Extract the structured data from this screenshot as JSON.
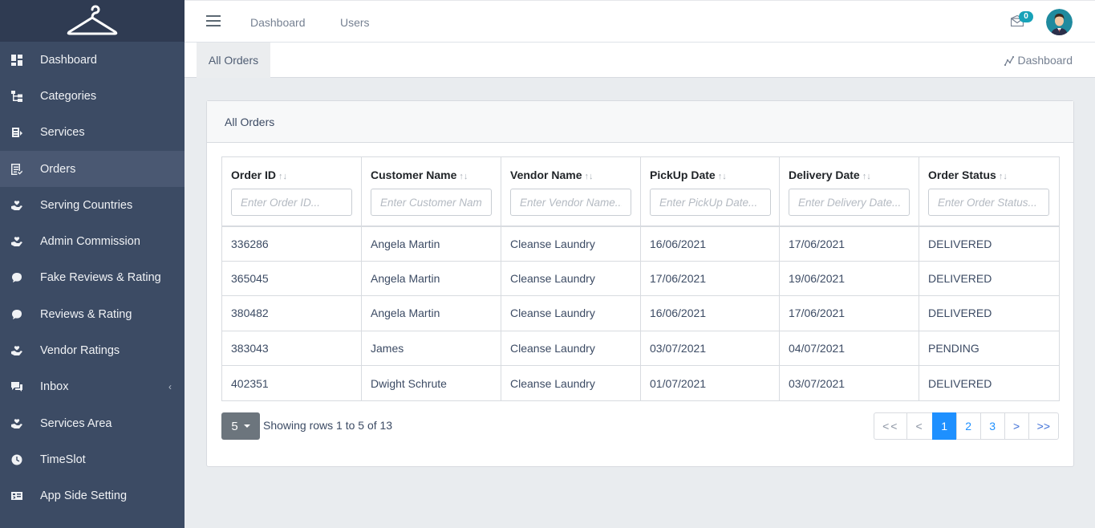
{
  "sidebar": {
    "items": [
      {
        "label": "Dashboard",
        "icon": "dashboard-icon"
      },
      {
        "label": "Categories",
        "icon": "sitemap-icon"
      },
      {
        "label": "Services",
        "icon": "services-icon"
      },
      {
        "label": "Orders",
        "icon": "orders-icon",
        "active": true
      },
      {
        "label": "Serving Countries",
        "icon": "hand-heart-icon"
      },
      {
        "label": "Admin Commission",
        "icon": "hand-heart-icon"
      },
      {
        "label": "Fake Reviews & Rating",
        "icon": "comment-icon"
      },
      {
        "label": "Reviews & Rating",
        "icon": "comment-icon"
      },
      {
        "label": "Vendor Ratings",
        "icon": "hand-heart-icon"
      },
      {
        "label": "Inbox",
        "icon": "inbox-icon",
        "caret": "‹"
      },
      {
        "label": "Services Area",
        "icon": "hand-heart-icon"
      },
      {
        "label": "TimeSlot",
        "icon": "clock-icon"
      },
      {
        "label": "App Side Setting",
        "icon": "settings-card-icon"
      }
    ]
  },
  "topbar": {
    "links": [
      "Dashboard",
      "Users"
    ],
    "mail_badge": "0"
  },
  "subheader": {
    "tab": "All Orders",
    "right_link": "Dashboard"
  },
  "card": {
    "title": "All Orders",
    "columns": [
      {
        "label": "Order ID",
        "placeholder": "Enter Order ID..."
      },
      {
        "label": "Customer Name",
        "placeholder": "Enter Customer Name..."
      },
      {
        "label": "Vendor Name",
        "placeholder": "Enter Vendor Name..."
      },
      {
        "label": "PickUp Date",
        "placeholder": "Enter PickUp Date..."
      },
      {
        "label": "Delivery Date",
        "placeholder": "Enter Delivery Date..."
      },
      {
        "label": "Order Status",
        "placeholder": "Enter Order Status..."
      }
    ],
    "rows": [
      [
        "336286",
        "Angela Martin",
        "Cleanse Laundry",
        "16/06/2021",
        "17/06/2021",
        "DELIVERED"
      ],
      [
        "365045",
        "Angela Martin",
        "Cleanse Laundry",
        "17/06/2021",
        "19/06/2021",
        "DELIVERED"
      ],
      [
        "380482",
        "Angela Martin",
        "Cleanse Laundry",
        "16/06/2021",
        "17/06/2021",
        "DELIVERED"
      ],
      [
        "383043",
        "James",
        "Cleanse Laundry",
        "03/07/2021",
        "04/07/2021",
        "PENDING"
      ],
      [
        "402351",
        "Dwight Schrute",
        "Cleanse Laundry",
        "01/07/2021",
        "03/07/2021",
        "DELIVERED"
      ]
    ],
    "page_size": "5",
    "showing": "Showing rows 1 to 5 of 13",
    "pagination": [
      "<<",
      "<",
      "1",
      "2",
      "3",
      ">",
      ">>"
    ],
    "active_page": "1"
  },
  "colors": {
    "sidebar_bg": "#3c4b64",
    "active_page": "#1e90ff",
    "badge": "#17a2b8"
  }
}
